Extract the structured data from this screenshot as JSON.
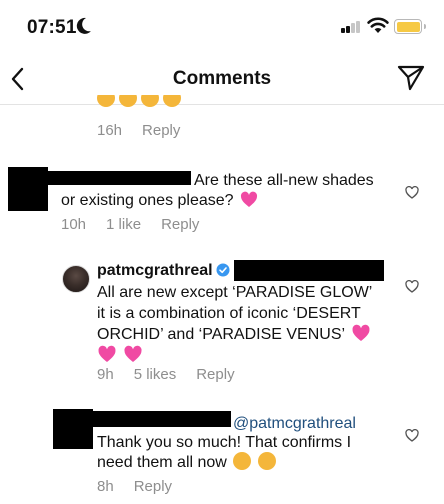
{
  "status_bar": {
    "time": "07:51"
  },
  "header": {
    "title": "Comments"
  },
  "comments": [
    {
      "meta": {
        "time": "16h",
        "reply": "Reply"
      }
    },
    {
      "text_line1": "Are these all-new shades",
      "text_line2": "or existing ones please?",
      "meta": {
        "time": "10h",
        "likes": "1 like",
        "reply": "Reply"
      }
    },
    {
      "username": "patmcgrathreal",
      "lines": [
        "All are new except ‘PARADISE GLOW’",
        "it is a combination of iconic ‘DESERT",
        "ORCHID’ and ‘PARADISE VENUS’"
      ],
      "meta": {
        "time": "9h",
        "likes": "5 likes",
        "reply": "Reply"
      }
    },
    {
      "mention": "@patmcgrathreal",
      "text_line1": "Thank you so much! That confirms I",
      "text_line2": "need them all now",
      "meta": {
        "time": "8h",
        "reply": "Reply"
      }
    }
  ],
  "colors": {
    "accent_verified": "#3897f0",
    "heart_emoji": "#f04aa3",
    "emoji_yellow": "#f4b63a",
    "battery": "#f6c944"
  },
  "icons": [
    "moon-icon",
    "cellular-signal-icon",
    "wifi-icon",
    "battery-icon",
    "back-chevron-icon",
    "send-direct-icon",
    "heart-icon",
    "verified-badge-icon",
    "sparkling-heart-emoji",
    "laughing-emoji",
    "heart-eyes-emoji"
  ]
}
